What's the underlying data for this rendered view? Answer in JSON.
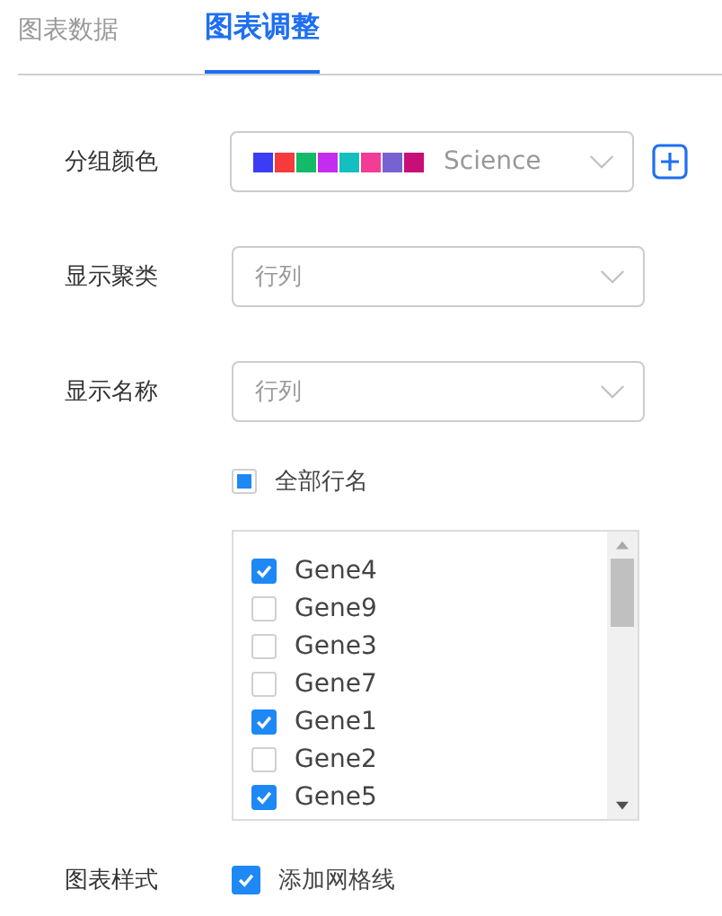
{
  "tabs": [
    {
      "label": "图表数据",
      "selected": false
    },
    {
      "label": "图表调整",
      "selected": true
    }
  ],
  "group_color": {
    "label": "分组颜色",
    "palette": [
      {
        "color": "#3b3cf4"
      },
      {
        "color": "#f53b3b"
      },
      {
        "color": "#12ba6a"
      },
      {
        "color": "#c42df0"
      },
      {
        "color": "#13bfbf"
      },
      {
        "color": "#f23c96"
      },
      {
        "color": "#7862d2"
      },
      {
        "color": "#c80f78"
      }
    ],
    "value": "Science"
  },
  "show_cluster": {
    "label": "显示聚类",
    "placeholder": "行列"
  },
  "show_names": {
    "label": "显示名称",
    "placeholder": "行列"
  },
  "all_rows": {
    "label": "全部行名",
    "checked": false,
    "indeterminate": true
  },
  "genes": [
    {
      "label": "Gene4",
      "checked": true
    },
    {
      "label": "Gene9",
      "checked": false
    },
    {
      "label": "Gene3",
      "checked": false
    },
    {
      "label": "Gene7",
      "checked": false
    },
    {
      "label": "Gene1",
      "checked": true
    },
    {
      "label": "Gene2",
      "checked": false
    },
    {
      "label": "Gene5",
      "checked": true
    }
  ],
  "chart_style": {
    "label": "图表样式",
    "option": {
      "label": "添加网格线",
      "checked": true
    }
  }
}
